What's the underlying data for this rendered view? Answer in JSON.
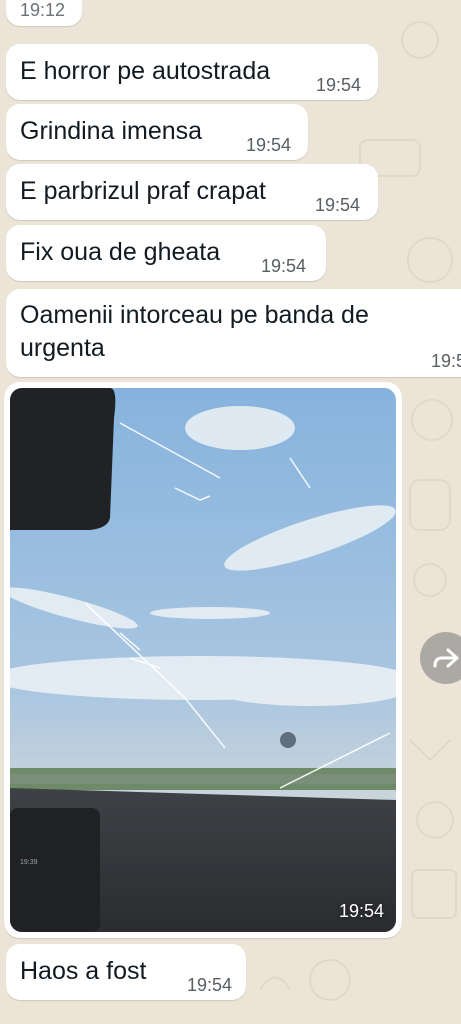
{
  "chat": {
    "messages": [
      {
        "text": "",
        "time": "19:12"
      },
      {
        "text": "E horror pe autostrada",
        "time": "19:54"
      },
      {
        "text": "Grindina imensa",
        "time": "19:54"
      },
      {
        "text": "E parbrizul praf crapat",
        "time": "19:54"
      },
      {
        "text": "Fix oua de gheata",
        "time": "19:54"
      },
      {
        "text": "Oamenii intorceau pe banda de urgenta",
        "time": "19:5"
      },
      {
        "text": "Haos a fost",
        "time": "19:54"
      }
    ],
    "media": {
      "time": "19:54",
      "dashboard_clock": "19:39"
    }
  },
  "colors": {
    "wallpaper": "#ece4d6",
    "bubble": "#ffffff",
    "text": "#111b21",
    "timestamp": "#595f63",
    "sky": "#8db6dd"
  },
  "icons": {
    "forward": "forward-arrow-icon"
  }
}
